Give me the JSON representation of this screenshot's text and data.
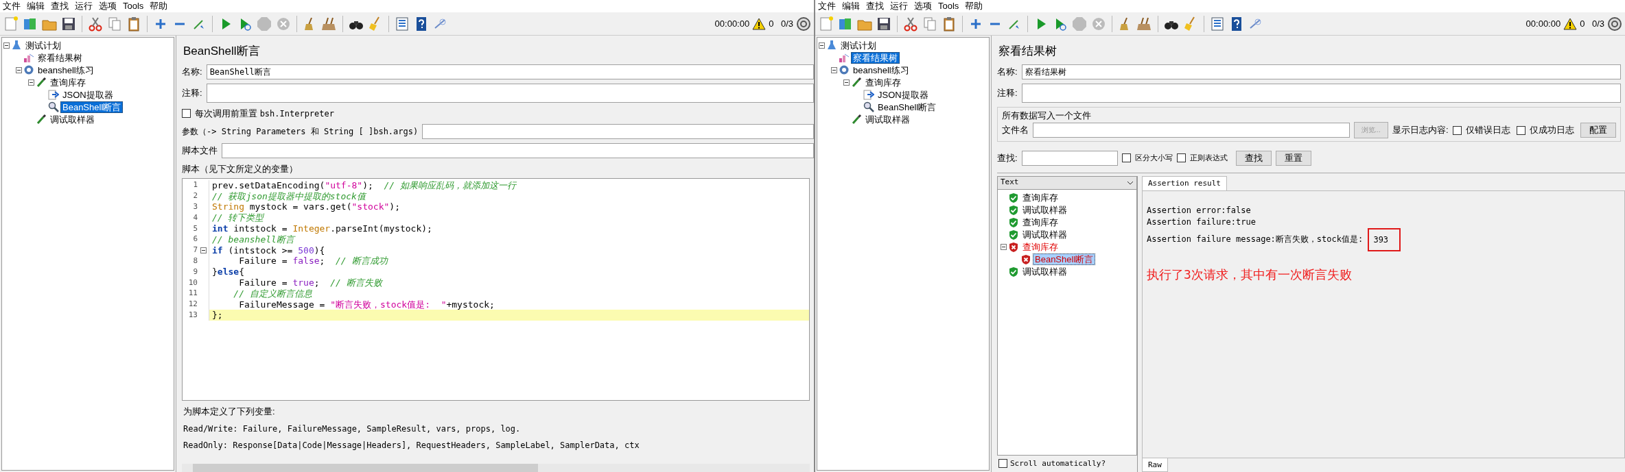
{
  "left_window": {
    "menu": [
      "文件",
      "编辑",
      "查找",
      "运行",
      "选项",
      "Tools",
      "帮助"
    ],
    "status": {
      "timer": "00:00:00",
      "warnings": "0",
      "threads": "0/3"
    },
    "tree": [
      {
        "label": "测试计划",
        "kind": "plan",
        "selected": false,
        "expanded": true,
        "children": [
          {
            "label": "察看结果树",
            "kind": "listener",
            "selected": false
          },
          {
            "label": "beanshell练习",
            "kind": "thread_group",
            "selected": false,
            "expanded": true,
            "children": [
              {
                "label": "查询库存",
                "kind": "sampler",
                "selected": false,
                "expanded": true,
                "children": [
                  {
                    "label": "JSON提取器",
                    "kind": "extractor",
                    "selected": false
                  },
                  {
                    "label": "BeanShell断言",
                    "kind": "assertion",
                    "selected": true
                  }
                ]
              },
              {
                "label": "调试取样器",
                "kind": "sampler",
                "selected": false
              }
            ]
          }
        ]
      }
    ],
    "panel": {
      "title": "BeanShell断言",
      "name_label": "名称:",
      "name_value": "BeanShell断言",
      "comment_label": "注释:",
      "reset_label": "每次调用前重置",
      "reset_code": "bsh.Interpreter",
      "reset_checked": false,
      "params_label": "参数（-> String Parameters 和 String [ ]bsh.args)",
      "file_label": "脚本文件",
      "script_label": "脚本（见下文所定义的变量）",
      "lines": [
        {
          "number": "1",
          "tokens": [
            {
              "kind": "plain",
              "text": "prev.setDataEncoding("
            },
            {
              "kind": "str",
              "text": "\"utf-8\""
            },
            {
              "kind": "plain",
              "text": ");  "
            },
            {
              "kind": "cmt",
              "text": "// 如果响应乱码，就添加这一行"
            }
          ]
        },
        {
          "number": "2",
          "tokens": [
            {
              "kind": "cmt",
              "text": "// 获取json提取器中提取的stock值"
            }
          ]
        },
        {
          "number": "3",
          "tokens": [
            {
              "kind": "type",
              "text": "String"
            },
            {
              "kind": "plain",
              "text": " mystock = vars.get("
            },
            {
              "kind": "str",
              "text": "\"stock\""
            },
            {
              "kind": "plain",
              "text": ");"
            }
          ]
        },
        {
          "number": "4",
          "tokens": [
            {
              "kind": "cmt",
              "text": "// 转下类型"
            }
          ]
        },
        {
          "number": "5",
          "tokens": [
            {
              "kind": "kw",
              "text": "int"
            },
            {
              "kind": "plain",
              "text": " intstock = "
            },
            {
              "kind": "type",
              "text": "Integer"
            },
            {
              "kind": "plain",
              "text": ".parseInt(mystock);"
            }
          ]
        },
        {
          "number": "6",
          "tokens": [
            {
              "kind": "cmt",
              "text": "// beanshell断言"
            }
          ]
        },
        {
          "number": "7",
          "fold": true,
          "tokens": [
            {
              "kind": "kw",
              "text": "if"
            },
            {
              "kind": "plain",
              "text": " (intstock >= "
            },
            {
              "kind": "num",
              "text": "500"
            },
            {
              "kind": "plain",
              "text": "){"
            }
          ]
        },
        {
          "number": "8",
          "tokens": [
            {
              "kind": "plain",
              "text": "     Failure = "
            },
            {
              "kind": "lit",
              "text": "false"
            },
            {
              "kind": "plain",
              "text": ";  "
            },
            {
              "kind": "cmt",
              "text": "// 断言成功"
            }
          ]
        },
        {
          "number": "9",
          "tokens": [
            {
              "kind": "plain",
              "text": "}"
            },
            {
              "kind": "kw",
              "text": "else"
            },
            {
              "kind": "plain",
              "text": "{"
            }
          ]
        },
        {
          "number": "10",
          "tokens": [
            {
              "kind": "plain",
              "text": "     Failure = "
            },
            {
              "kind": "lit",
              "text": "true"
            },
            {
              "kind": "plain",
              "text": ";  "
            },
            {
              "kind": "cmt",
              "text": "// 断言失败"
            }
          ]
        },
        {
          "number": "11",
          "tokens": [
            {
              "kind": "cmt",
              "text": "    // 自定义断言信息"
            }
          ]
        },
        {
          "number": "12",
          "tokens": [
            {
              "kind": "plain",
              "text": "     FailureMessage = "
            },
            {
              "kind": "str",
              "text": "\"断言失败，stock值是:  \""
            },
            {
              "kind": "plain",
              "text": "+mystock;"
            }
          ]
        },
        {
          "number": "13",
          "current": true,
          "tokens": [
            {
              "kind": "plain",
              "text": "};"
            }
          ]
        }
      ],
      "vars_title": "为脚本定义了下列变量:",
      "vars_lines": [
        "Read/Write: Failure, FailureMessage, SampleResult, vars, props, log.",
        "ReadOnly: Response[Data|Code|Message|Headers], RequestHeaders, SampleLabel, SamplerData, ctx"
      ]
    }
  },
  "right_window": {
    "menu": [
      "文件",
      "编辑",
      "查找",
      "运行",
      "选项",
      "Tools",
      "帮助"
    ],
    "status": {
      "timer": "00:00:00",
      "warnings": "0",
      "threads": "0/3"
    },
    "tree": [
      {
        "label": "测试计划",
        "kind": "plan",
        "selected": false,
        "expanded": true,
        "children": [
          {
            "label": "察看结果树",
            "kind": "listener",
            "selected": true
          },
          {
            "label": "beanshell练习",
            "kind": "thread_group",
            "selected": false,
            "expanded": true,
            "children": [
              {
                "label": "查询库存",
                "kind": "sampler",
                "selected": false,
                "expanded": true,
                "children": [
                  {
                    "label": "JSON提取器",
                    "kind": "extractor",
                    "selected": false
                  },
                  {
                    "label": "BeanShell断言",
                    "kind": "assertion",
                    "selected": false
                  }
                ]
              },
              {
                "label": "调试取样器",
                "kind": "sampler",
                "selected": false
              }
            ]
          }
        ]
      }
    ],
    "panel": {
      "title": "察看结果树",
      "name_label": "名称:",
      "name_value": "察看结果树",
      "comment_label": "注释:",
      "file_group": "所有数据写入一个文件",
      "file_label": "文件名",
      "browse": "浏览...",
      "log_label": "显示日志内容:",
      "log_options": [
        {
          "label": "仅错误日志",
          "checked": false
        },
        {
          "label": "仅成功日志",
          "checked": false
        }
      ],
      "config": "配置",
      "find_label": "查找:",
      "find_options": [
        {
          "label": "区分大小写",
          "checked": false
        },
        {
          "label": "正则表达式",
          "checked": false
        }
      ],
      "find_button": "查找",
      "reset_button": "重置",
      "view_mode": "Text",
      "results": [
        {
          "label": "查询库存",
          "failed": false,
          "selected": false
        },
        {
          "label": "调试取样器",
          "failed": false,
          "selected": false
        },
        {
          "label": "查询库存",
          "failed": false,
          "selected": false
        },
        {
          "label": "调试取样器",
          "failed": false,
          "selected": false
        },
        {
          "label": "查询库存",
          "failed": true,
          "selected": false,
          "expanded": true,
          "children": [
            {
              "label": "BeanShell断言",
              "failed": true,
              "selected": true
            }
          ]
        },
        {
          "label": "调试取样器",
          "failed": false,
          "selected": false
        }
      ],
      "scroll_label": "Scroll automatically?",
      "scroll_checked": false,
      "tabs": [
        {
          "label": "Assertion result",
          "selected": true
        }
      ],
      "result_lines": [
        "Assertion error:false",
        "Assertion failure:true",
        "Assertion failure message:断言失败，stock值是: "
      ],
      "result_value": "393",
      "note": "执行了3次请求，其中有一次断言失败",
      "bottom_tabs": [
        {
          "label": "Raw",
          "selected": true
        }
      ]
    }
  }
}
